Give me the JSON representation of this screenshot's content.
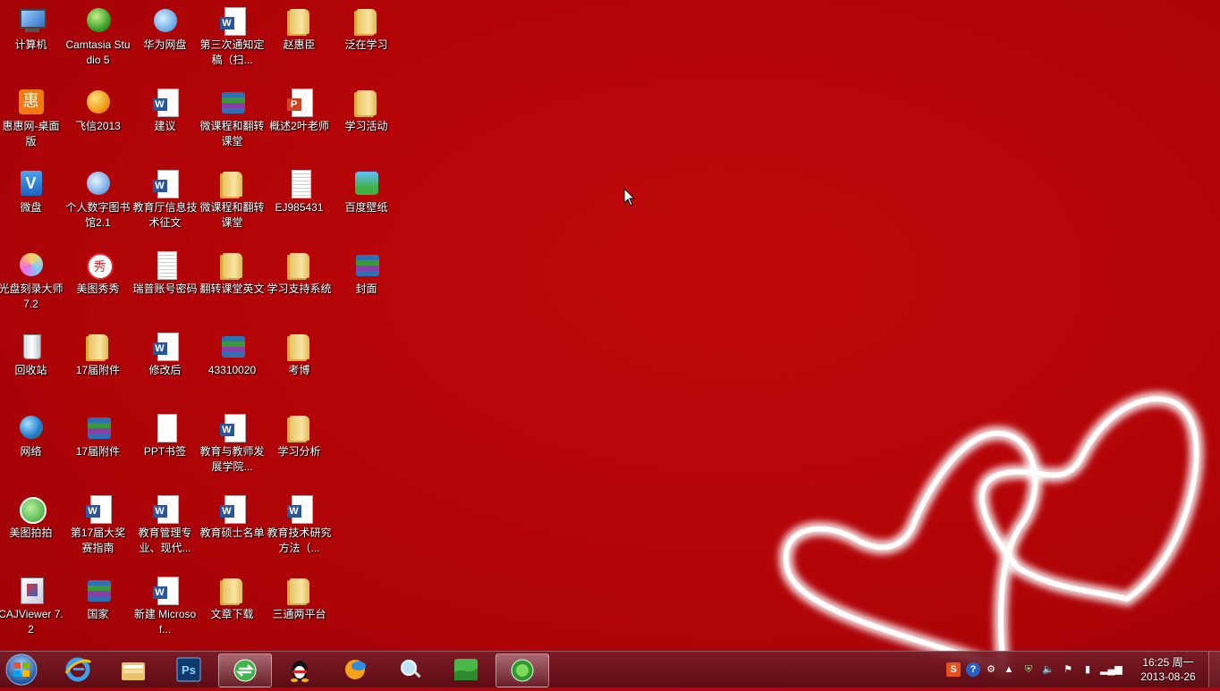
{
  "desktop": {
    "icons": [
      {
        "label": "计算机",
        "type": "computer"
      },
      {
        "label": "Camtasia Studio 5",
        "type": "globe"
      },
      {
        "label": "华为网盘",
        "type": "huawei"
      },
      {
        "label": "第三次通知定稿（扫...",
        "type": "word"
      },
      {
        "label": "赵惠臣",
        "type": "folder"
      },
      {
        "label": "泛在学习",
        "type": "folder"
      },
      {
        "label": "惠惠网-桌面版",
        "type": "orange"
      },
      {
        "label": "飞信2013",
        "type": "feixin"
      },
      {
        "label": "建议",
        "type": "word"
      },
      {
        "label": "微课程和翻转课堂",
        "type": "rar"
      },
      {
        "label": "概述2叶老师",
        "type": "ppt"
      },
      {
        "label": "学习活动",
        "type": "folder"
      },
      {
        "label": "微盘",
        "type": "weipan"
      },
      {
        "label": "个人数字图书馆2.1",
        "type": "library"
      },
      {
        "label": "教育厅信息技术征文",
        "type": "word"
      },
      {
        "label": "微课程和翻转课堂",
        "type": "folder"
      },
      {
        "label": "EJ985431",
        "type": "text"
      },
      {
        "label": "百度壁纸",
        "type": "wallpaper"
      },
      {
        "label": "光盘刻录大师 7.2",
        "type": "disc"
      },
      {
        "label": "美图秀秀",
        "type": "meitu"
      },
      {
        "label": "瑞普账号密码",
        "type": "text"
      },
      {
        "label": "翻转课堂英文",
        "type": "folder"
      },
      {
        "label": "学习支持系统",
        "type": "folder"
      },
      {
        "label": "封面",
        "type": "rar"
      },
      {
        "label": "回收站",
        "type": "recycle"
      },
      {
        "label": "17届附件",
        "type": "folder"
      },
      {
        "label": "修改后",
        "type": "word"
      },
      {
        "label": "43310020",
        "type": "rar"
      },
      {
        "label": "考博",
        "type": "folder"
      },
      {
        "label": "网络",
        "type": "network"
      },
      {
        "label": "17届附件",
        "type": "rar"
      },
      {
        "label": "PPT书签",
        "type": "blank"
      },
      {
        "label": "教育与教师发展学院...",
        "type": "word"
      },
      {
        "label": "学习分析",
        "type": "folder"
      },
      {
        "label": "美图拍拍",
        "type": "mtpp"
      },
      {
        "label": "第17届大奖赛指南",
        "type": "word"
      },
      {
        "label": "教育管理专业、现代...",
        "type": "word"
      },
      {
        "label": "教育硕士名单",
        "type": "word"
      },
      {
        "label": "教育技术研究方法（...",
        "type": "word"
      },
      {
        "label": "CAJViewer 7.2",
        "type": "caj"
      },
      {
        "label": "国家",
        "type": "rar"
      },
      {
        "label": "新建 Microsof...",
        "type": "word"
      },
      {
        "label": "文章下载",
        "type": "folder"
      },
      {
        "label": "三通两平台",
        "type": "folder"
      }
    ]
  },
  "taskbar": {
    "buttons": [
      {
        "name": "ie",
        "icon": "ie-icon"
      },
      {
        "name": "explorer",
        "icon": "folder-icon"
      },
      {
        "name": "photoshop",
        "icon": "photoshop-icon",
        "text": "Ps"
      },
      {
        "name": "sync-app",
        "icon": "sync-icon",
        "active": true
      },
      {
        "name": "qq",
        "icon": "penguin-icon"
      },
      {
        "name": "feixin",
        "icon": "feixin-icon"
      },
      {
        "name": "magnifier",
        "icon": "search-people-icon"
      },
      {
        "name": "wallpaper",
        "icon": "wallpaper-icon"
      },
      {
        "name": "camtasia",
        "icon": "camtasia-icon",
        "active": true
      }
    ],
    "tray": {
      "ime": "S",
      "help": "?",
      "time": "16:25 周一",
      "date": "2013-08-26"
    }
  },
  "colors": {
    "background": "#b20408",
    "taskbar": "#5a0c16"
  }
}
